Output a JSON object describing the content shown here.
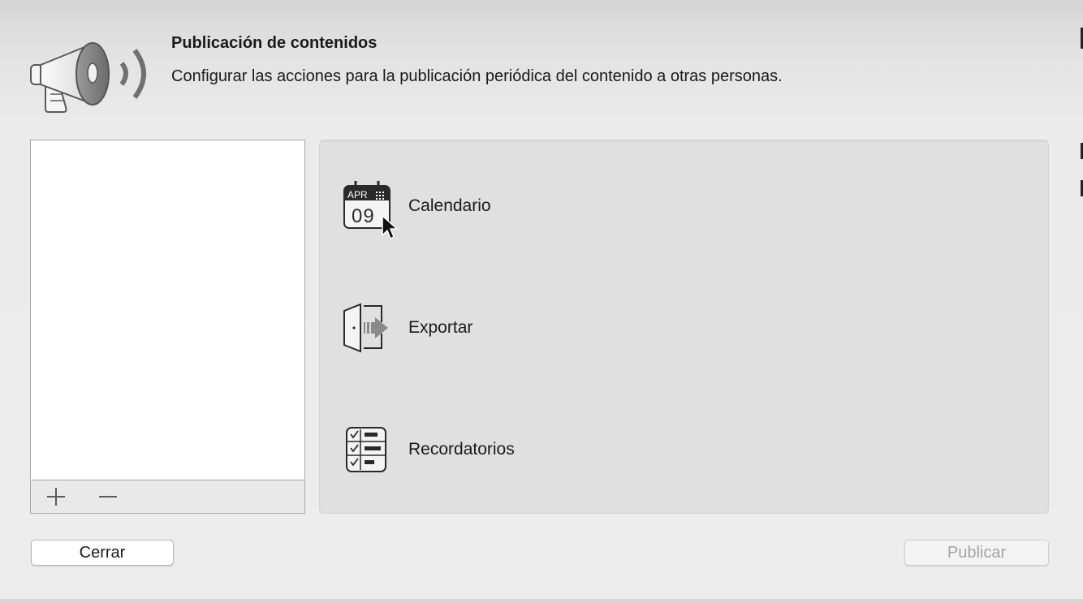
{
  "header": {
    "icon": "megaphone-icon",
    "title": "Publicación de contenidos",
    "subtitle": "Configurar las acciones para la publicación periódica del contenido a otras personas."
  },
  "list": {
    "items": [],
    "add_icon": "plus-icon",
    "remove_icon": "minus-icon"
  },
  "actions": [
    {
      "label": "Calendario",
      "icon": "calendar-icon",
      "calendar_month": "APR",
      "calendar_day": "09"
    },
    {
      "label": "Exportar",
      "icon": "export-door-icon"
    },
    {
      "label": "Recordatorios",
      "icon": "reminders-checklist-icon"
    }
  ],
  "footer": {
    "close_label": "Cerrar",
    "publish_label": "Publicar",
    "publish_enabled": false
  },
  "colors": {
    "background": "#ececec",
    "panel": "#e0e0e0",
    "disabled_text": "#a5a5a5"
  }
}
